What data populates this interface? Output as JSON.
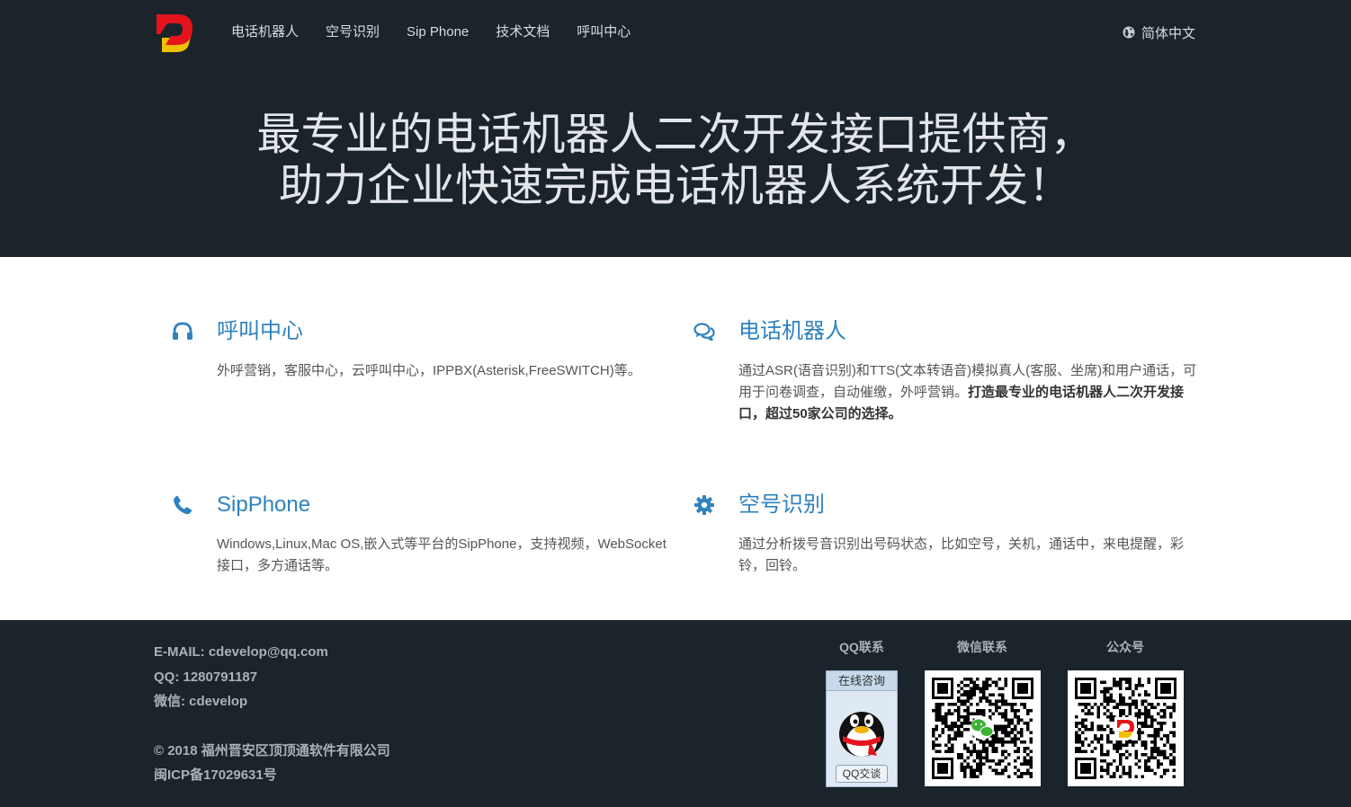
{
  "nav": {
    "items": [
      "电话机器人",
      "空号识别",
      "Sip Phone",
      "技术文档",
      "呼叫中心"
    ],
    "language": "简体中文"
  },
  "hero": {
    "line1": "最专业的电话机器人二次开发接口提供商，",
    "line2": "助力企业快速完成电话机器人系统开发！"
  },
  "features": {
    "callcenter": {
      "title": "呼叫中心",
      "desc": "外呼营销，客服中心，云呼叫中心，IPPBX(Asterisk,FreeSWITCH)等。"
    },
    "robot": {
      "title": "电话机器人",
      "desc": "通过ASR(语音识别)和TTS(文本转语音)模拟真人(客服、坐席)和用户通话，可用于问卷调查，自动催缴，外呼营销。",
      "desc_bold": "打造最专业的电话机器人二次开发接口，超过50家公司的选择。"
    },
    "sipphone": {
      "title": "SipPhone",
      "desc": "Windows,Linux,Mac OS,嵌入式等平台的SipPhone，支持视频，WebSocket接口，多方通话等。"
    },
    "emptynum": {
      "title": "空号识别",
      "desc": "通过分析拨号音识别出号码状态，比如空号，关机，通话中，来电提醒，彩铃，回铃。"
    }
  },
  "footer": {
    "email": "E-MAIL: cdevelop@qq.com",
    "qq": "QQ: 1280791187",
    "wechat": "微信: cdevelop",
    "copyright": "© 2018 福州晋安区顶顶通软件有限公司",
    "icp": "闽ICP备17029631号",
    "qr_labels": [
      "QQ联系",
      "微信联系",
      "公众号"
    ],
    "qq_widget_top": "在线咨询",
    "qq_widget_bottom": "QQ交谈"
  },
  "colors": {
    "header_bg": "#1b232b",
    "accent": "#2e82bf",
    "logo_red": "#e5141c",
    "logo_yellow": "#f1c100"
  },
  "icons": {
    "callcenter": "headset-icon",
    "robot": "chat-bubbles-icon",
    "sipphone": "phone-icon",
    "emptynum": "gear-icon",
    "language": "globe-icon"
  }
}
